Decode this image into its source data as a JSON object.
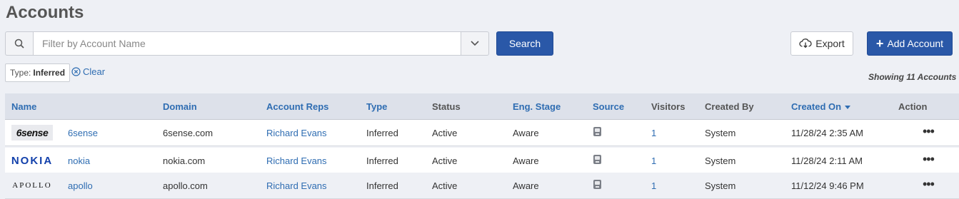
{
  "page": {
    "title": "Accounts"
  },
  "search": {
    "placeholder": "Filter by Account Name",
    "button_label": "Search"
  },
  "toolbar": {
    "export_label": "Export",
    "add_label": "Add Account"
  },
  "filters": {
    "chip_key": "Type:",
    "chip_value": "Inferred",
    "clear_label": "Clear"
  },
  "summary": {
    "showing_text": "Showing 11 Accounts"
  },
  "table": {
    "columns": [
      "Name",
      "Domain",
      "Account Reps",
      "Type",
      "Status",
      "Eng. Stage",
      "Source",
      "Visitors",
      "Created By",
      "Created On",
      "Action"
    ],
    "sort_column": "Created On",
    "rows": [
      {
        "logo_text": "6sense",
        "name": "6sense",
        "domain": "6sense.com",
        "reps": "Richard Evans",
        "type": "Inferred",
        "status": "Active",
        "stage": "Aware",
        "source_icon": "device-icon",
        "visitors": "1",
        "created_by": "System",
        "created_on": "11/28/24 2:35 AM",
        "action": "•••"
      },
      {
        "logo_text": "NOKIA",
        "name": "nokia",
        "domain": "nokia.com",
        "reps": "Richard Evans",
        "type": "Inferred",
        "status": "Active",
        "stage": "Aware",
        "source_icon": "device-icon",
        "visitors": "1",
        "created_by": "System",
        "created_on": "11/28/24 2:11 AM",
        "action": "•••"
      },
      {
        "logo_text": "APOLLO",
        "name": "apollo",
        "domain": "apollo.com",
        "reps": "Richard Evans",
        "type": "Inferred",
        "status": "Active",
        "stage": "Aware",
        "source_icon": "device-icon",
        "visitors": "1",
        "created_by": "System",
        "created_on": "11/12/24 9:46 PM",
        "action": "•••"
      }
    ]
  },
  "colors": {
    "primary": "#2a58a8",
    "link": "#2f6db2",
    "header_bg": "#dde1ea",
    "page_bg": "#eef0f5"
  }
}
